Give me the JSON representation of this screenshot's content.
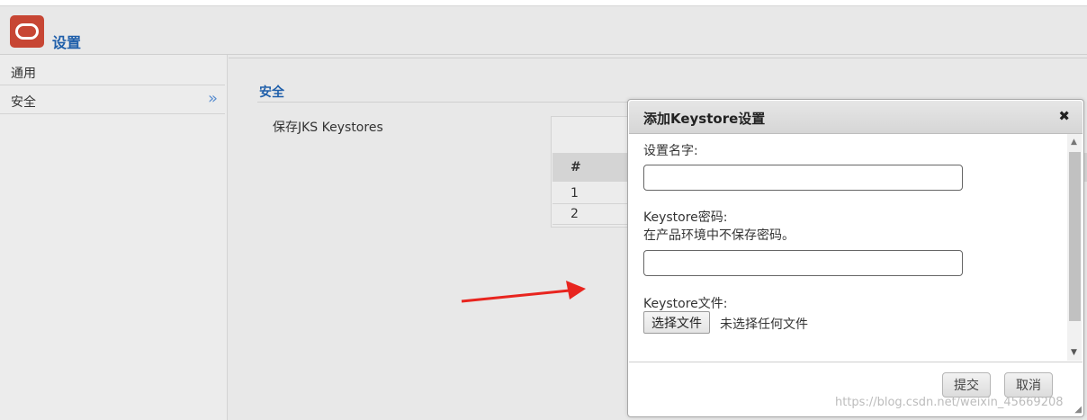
{
  "header": {
    "title": "设置"
  },
  "sidebar": {
    "items": [
      {
        "label": "通用"
      },
      {
        "label": "安全"
      }
    ]
  },
  "main": {
    "section_title": "安全",
    "field_label": "保存JKS Keystores",
    "table": {
      "header": "#",
      "rows": [
        "1",
        "2"
      ]
    }
  },
  "dialog": {
    "title": "添加Keystore设置",
    "name_label": "设置名字:",
    "name_value": "",
    "password_label": "Keystore密码:",
    "password_note": "在产品环境中不保存密码。",
    "password_value": "",
    "file_label": "Keystore文件:",
    "choose_file_label": "选择文件",
    "file_status": "未选择任何文件",
    "submit_label": "提交",
    "cancel_label": "取消"
  },
  "watermark": "https://blog.csdn.net/weixin_45669208",
  "colors": {
    "brand": "#c74634",
    "link": "#1f5faa",
    "arrow": "#e8251f"
  }
}
